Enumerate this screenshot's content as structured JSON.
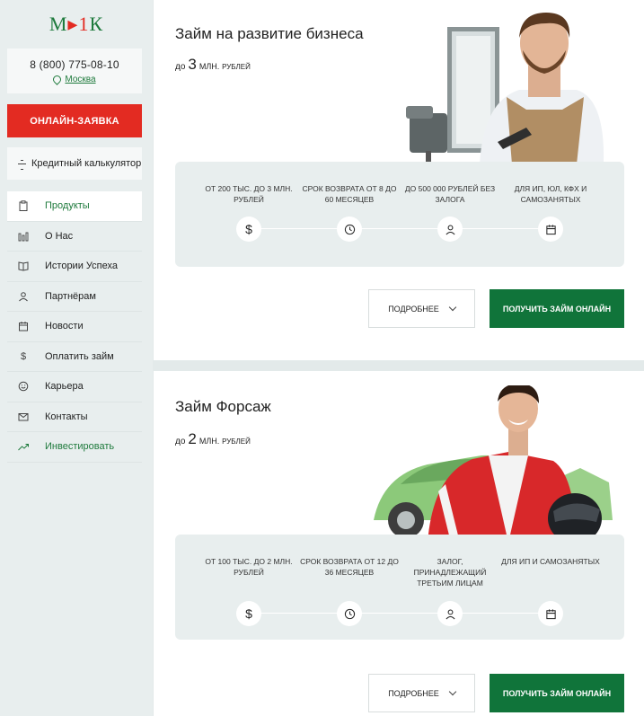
{
  "sidebar": {
    "logo": {
      "left": "М",
      "mid": "▸",
      "red": "1",
      "right": "К"
    },
    "phone": "8 (800) 775-08-10",
    "city": "Москва",
    "apply_label": "ОНЛАЙН-ЗАЯВКА",
    "calculator_label": "Кредитный калькулятор",
    "menu": [
      {
        "label": "Продукты",
        "icon": "clipboard-icon"
      },
      {
        "label": "О Нас",
        "icon": "bars-icon"
      },
      {
        "label": "Истории Успеха",
        "icon": "book-icon"
      },
      {
        "label": "Партнёрам",
        "icon": "user-icon"
      },
      {
        "label": "Новости",
        "icon": "calendar-icon"
      },
      {
        "label": "Оплатить займ",
        "icon": "dollar-icon"
      },
      {
        "label": "Карьера",
        "icon": "smile-icon"
      },
      {
        "label": "Контакты",
        "icon": "mail-icon"
      },
      {
        "label": "Инвестировать",
        "icon": "trend-up-icon"
      }
    ]
  },
  "cards": [
    {
      "title": "Займ на развитие бизнеса",
      "amount_prefix": "до",
      "amount_value": "3",
      "amount_unit": "МЛН.",
      "amount_suffix": "РУБЛЕЙ",
      "features": [
        {
          "text": "ОТ 200 ТЫС. ДО 3 МЛН. РУБЛЕЙ",
          "icon": "dollar-icon"
        },
        {
          "text": "СРОК ВОЗВРАТА ОТ 8 ДО 60 МЕСЯЦЕВ",
          "icon": "clock-icon"
        },
        {
          "text": "ДО 500 000 РУБЛЕЙ БЕЗ ЗАЛОГА",
          "icon": "user-icon"
        },
        {
          "text": "ДЛЯ ИП, ЮЛ, КФХ И САМОЗАНЯТЫХ",
          "icon": "calendar-icon"
        }
      ],
      "more_label": "ПОДРОБНЕЕ",
      "get_label": "ПОЛУЧИТЬ ЗАЙМ ОНЛАЙН"
    },
    {
      "title": "Займ Форсаж",
      "amount_prefix": "до",
      "amount_value": "2",
      "amount_unit": "МЛН.",
      "amount_suffix": "РУБЛЕЙ",
      "features": [
        {
          "text": "ОТ 100 ТЫС. ДО 2 МЛН. РУБЛЕЙ",
          "icon": "dollar-icon"
        },
        {
          "text": "СРОК ВОЗВРАТА ОТ 12 ДО 36 МЕСЯЦЕВ",
          "icon": "clock-icon"
        },
        {
          "text": "ЗАЛОГ, ПРИНАДЛЕЖАЩИЙ ТРЕТЬИМ ЛИЦАМ",
          "icon": "user-icon"
        },
        {
          "text": "ДЛЯ ИП И САМОЗАНЯТЫХ",
          "icon": "calendar-icon"
        }
      ],
      "more_label": "ПОДРОБНЕЕ",
      "get_label": "ПОЛУЧИТЬ ЗАЙМ ОНЛАЙН"
    }
  ],
  "colors": {
    "brand_green": "#10743a",
    "brand_red": "#e32b22",
    "sidebar_bg": "#e8eeee"
  }
}
